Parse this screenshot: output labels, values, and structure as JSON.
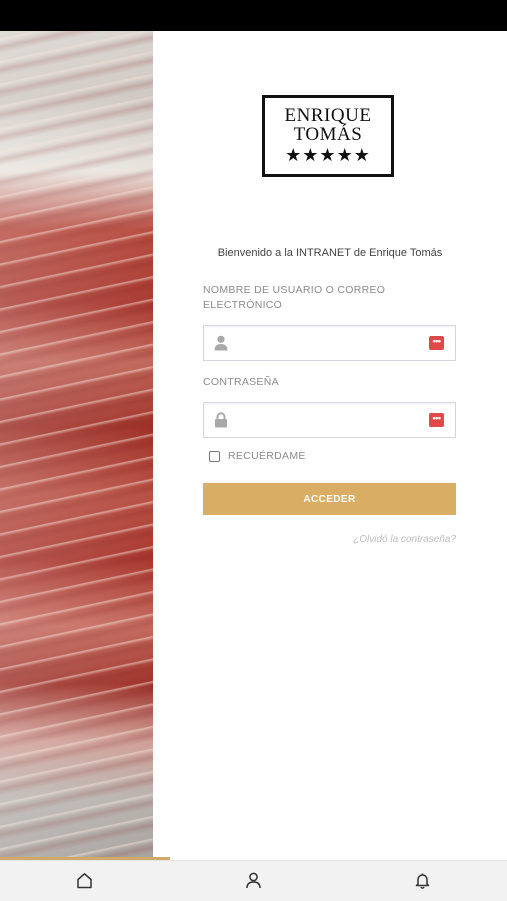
{
  "logo": {
    "line1": "ENRIQUE",
    "line2": "TOMÁS",
    "stars": "★★★★★"
  },
  "welcome_text": "Bienvenido a la INTRANET de Enrique Tomás",
  "username": {
    "label": "NOMBRE DE USUARIO O CORREO ELECTRÓNICO",
    "value": "",
    "placeholder": "",
    "icon": "user-icon"
  },
  "password": {
    "label": "CONTRASEÑA",
    "value": "",
    "placeholder": "",
    "icon": "lock-icon"
  },
  "password_manager_badge": "•••",
  "remember_label": "RECUÉRDAME",
  "submit_label": "ACCEDER",
  "forgot_link": "¿Olvidó la contraseña?",
  "tabs": [
    {
      "name": "home",
      "icon": "home-icon"
    },
    {
      "name": "profile",
      "icon": "user-icon"
    },
    {
      "name": "notifications",
      "icon": "bell-icon"
    }
  ],
  "colors": {
    "accent": "#d9ad63",
    "badge": "#e14949",
    "text": "#444444",
    "label": "#8b8b8b"
  }
}
